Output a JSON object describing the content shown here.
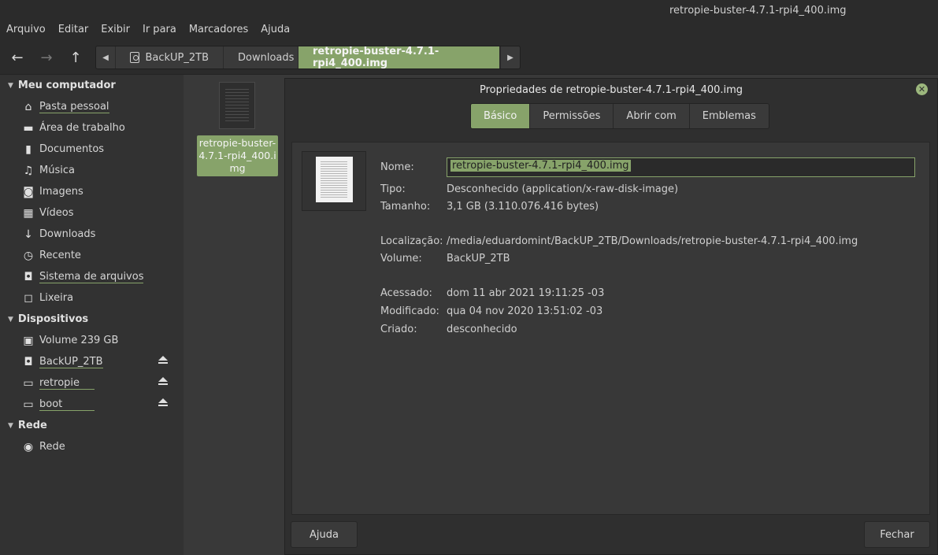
{
  "window": {
    "title": "retropie-buster-4.7.1-rpi4_400.img"
  },
  "menu": [
    "Arquivo",
    "Editar",
    "Exibir",
    "Ir para",
    "Marcadores",
    "Ajuda"
  ],
  "toolbar": {
    "back": "←",
    "forward": "→",
    "up": "↑",
    "crumb_left": "◀",
    "crumb_right": "▶",
    "crumbs": [
      "BackUP_2TB",
      "Downloads",
      "retropie-buster-4.7.1-rpi4_400.img"
    ]
  },
  "sidebar": {
    "sections": [
      {
        "title": "Meu computador",
        "items": [
          "Pasta pessoal",
          "Área de trabalho",
          "Documentos",
          "Música",
          "Imagens",
          "Vídeos",
          "Downloads",
          "Recente",
          "Sistema de arquivos",
          "Lixeira"
        ]
      },
      {
        "title": "Dispositivos",
        "items": [
          "Volume 239 GB",
          "BackUP_2TB",
          "retropie",
          "boot"
        ]
      },
      {
        "title": "Rede",
        "items": [
          "Rede"
        ]
      }
    ]
  },
  "file": {
    "label": "retropie-buster-4.7.1-rpi4_400.img"
  },
  "dialog": {
    "title": "Propriedades de retropie-buster-4.7.1-rpi4_400.img",
    "close": "✕",
    "tabs": [
      "Básico",
      "Permissões",
      "Abrir com",
      "Emblemas"
    ],
    "labels": {
      "nome": "Nome:",
      "tipo": "Tipo:",
      "tamanho": "Tamanho:",
      "localizacao": "Localização:",
      "volume": "Volume:",
      "acessado": "Acessado:",
      "modificado": "Modificado:",
      "criado": "Criado:"
    },
    "values": {
      "nome": "retropie-buster-4.7.1-rpi4_400.img",
      "tipo": "Desconhecido (application/x-raw-disk-image)",
      "tamanho": "3,1 GB (3.110.076.416 bytes)",
      "localizacao": "/media/eduardomint/BackUP_2TB/Downloads/retropie-buster-4.7.1-rpi4_400.img",
      "volume": "BackUP_2TB",
      "acessado": "dom 11 abr 2021 19:11:25 -03",
      "modificado": "qua 04 nov 2020 13:51:02 -03",
      "criado": "desconhecido"
    },
    "buttons": {
      "help": "Ajuda",
      "close": "Fechar"
    }
  },
  "colors": {
    "accent": "#87a36a"
  }
}
